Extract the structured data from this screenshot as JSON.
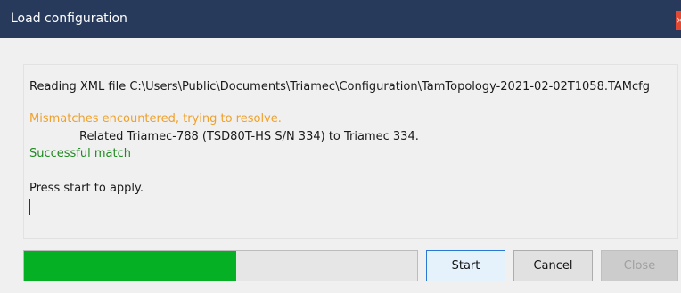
{
  "window": {
    "title": "Load configuration",
    "close_glyph": "×"
  },
  "log": {
    "lines": [
      "Reading XML file C:\\Users\\Public\\Documents\\Triamec\\Configuration\\TamTopology-2021-02-02T1058.TAMcfg",
      "Mismatches encountered, trying to resolve.",
      "Related Triamec-788 (TSD80T-HS S/N 334) to Triamec 334.",
      "Successful match",
      "Press start to apply."
    ]
  },
  "progress": {
    "fraction": 0.54,
    "color": "#06b025"
  },
  "buttons": {
    "start": "Start",
    "cancel": "Cancel",
    "close": "Close"
  },
  "colors": {
    "titlebar": "#283a5c",
    "warning": "#f0a12a",
    "success": "#1f8a1f"
  }
}
